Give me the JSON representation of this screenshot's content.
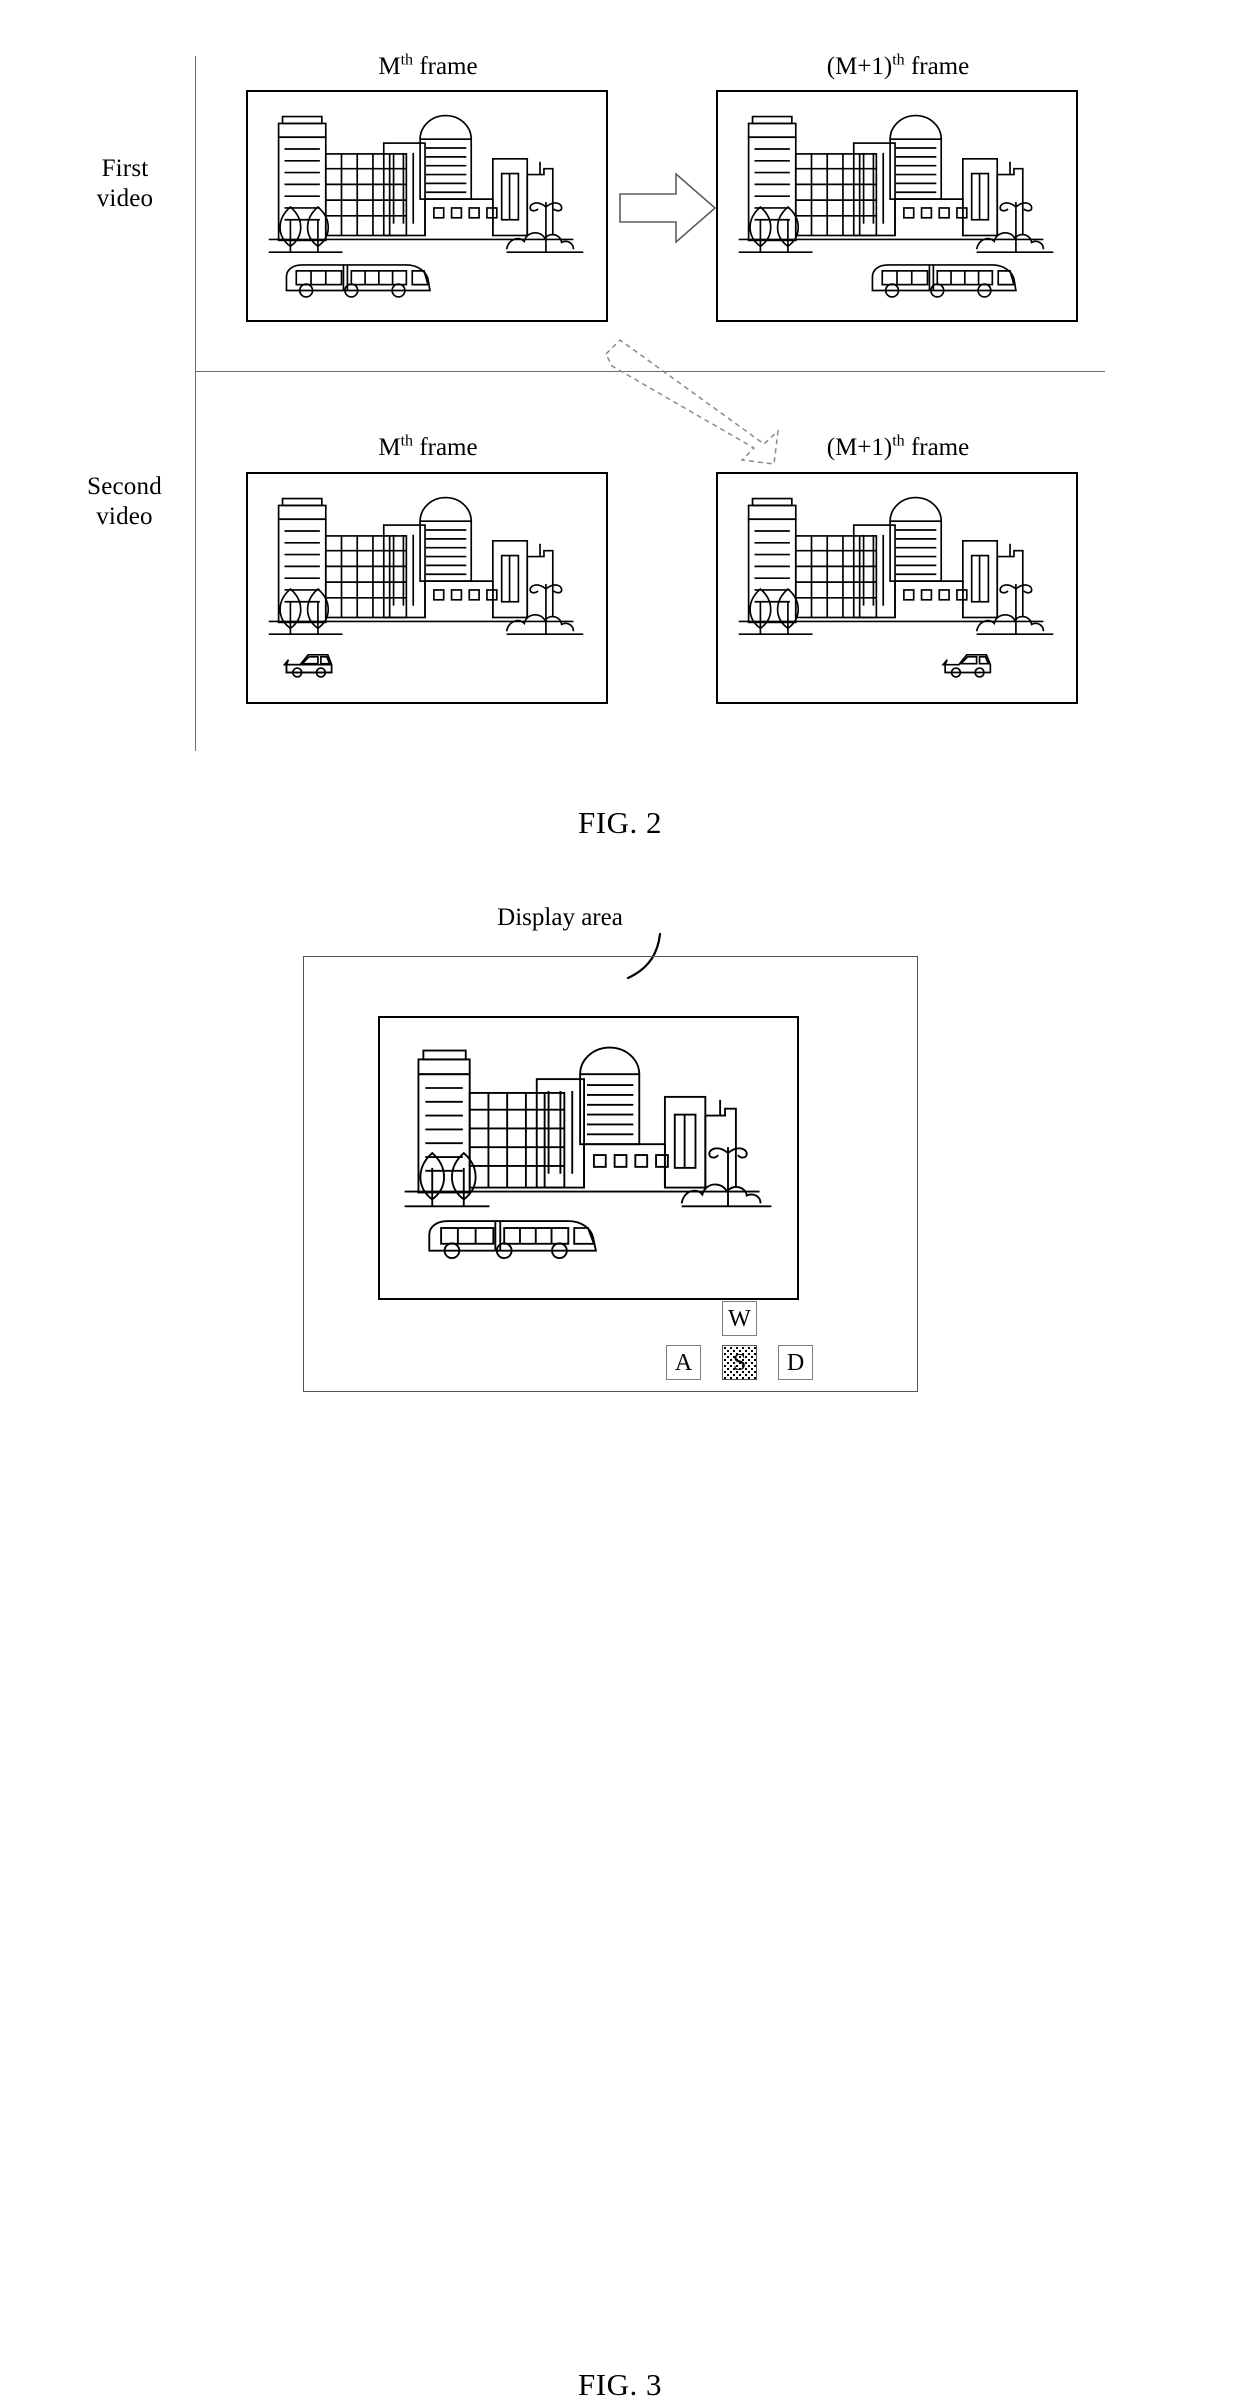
{
  "figure2": {
    "caption": "FIG. 2",
    "row_labels": [
      {
        "id": "first-video",
        "line1": "First",
        "line2": "video"
      },
      {
        "id": "second-video",
        "line1": "Second",
        "line2": "video"
      }
    ],
    "column_captions": {
      "m_frame": "M",
      "m_frame_sup": "th",
      "m_frame_tail": " frame",
      "m1_frame": "(M+1)",
      "m1_frame_sup": "th",
      "m1_frame_tail": " frame"
    },
    "cells": [
      {
        "row": "First video",
        "col": "Mth frame",
        "vehicle": "bus",
        "vehicle_position": "left"
      },
      {
        "row": "First video",
        "col": "(M+1)th frame",
        "vehicle": "bus",
        "vehicle_position": "right"
      },
      {
        "row": "Second video",
        "col": "Mth frame",
        "vehicle": "car",
        "vehicle_position": "left"
      },
      {
        "row": "Second video",
        "col": "(M+1)th frame",
        "vehicle": "car",
        "vehicle_position": "right"
      }
    ],
    "arrows": [
      {
        "id": "solid-right-arrow",
        "style": "solid-outline",
        "direction": "right"
      },
      {
        "id": "dashed-diagonal-arrow",
        "style": "dashed-outline",
        "direction": "down-right"
      }
    ]
  },
  "figure3": {
    "caption": "FIG. 3",
    "display_area_label": "Display area",
    "keys": [
      {
        "id": "key-w",
        "label": "W",
        "state": "normal"
      },
      {
        "id": "key-a",
        "label": "A",
        "state": "normal"
      },
      {
        "id": "key-s",
        "label": "S",
        "state": "pressed"
      },
      {
        "id": "key-d",
        "label": "D",
        "state": "normal"
      }
    ],
    "scene": {
      "vehicle": "bus",
      "vehicle_position": "left"
    }
  },
  "colors": {
    "ink": "#000000",
    "rule": "#6b6b6b",
    "key_border": "#7d7d7d",
    "display_border": "#555555"
  }
}
